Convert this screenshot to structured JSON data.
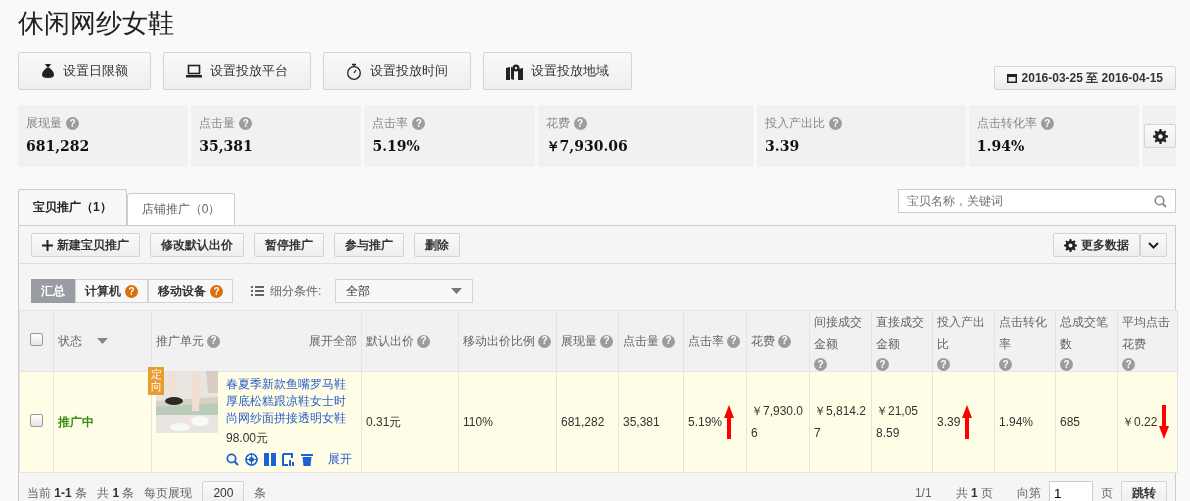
{
  "title": "休闲网纱女鞋",
  "actions": [
    {
      "kind": "money",
      "label": "设置日限额"
    },
    {
      "kind": "laptop",
      "label": "设置投放平台"
    },
    {
      "kind": "timer",
      "label": "设置投放时间"
    },
    {
      "kind": "map",
      "label": "设置投放地域"
    }
  ],
  "date_range": "2016-03-25 至 2016-04-15",
  "stats": [
    {
      "label": "展现量",
      "help": "?",
      "value": "681,282"
    },
    {
      "label": "点击量",
      "help": "?",
      "value": "35,381"
    },
    {
      "label": "点击率",
      "help": "?",
      "value": "5.19%"
    },
    {
      "label": "花费",
      "help": "?",
      "value": "￥7,930.06"
    },
    {
      "label": "投入产出比",
      "help": "?",
      "value": "3.39"
    },
    {
      "label": "点击转化率",
      "help": "?",
      "value": "1.94%"
    }
  ],
  "tabs": [
    {
      "label": "宝贝推广（1）",
      "selected": true
    },
    {
      "label": "店铺推广（0）",
      "selected": false
    }
  ],
  "search": {
    "placeholder": "宝贝名称，关键词"
  },
  "toolbar": [
    {
      "kind": "add",
      "label": "新建宝贝推广"
    },
    {
      "kind": "plain",
      "label": "修改默认出价"
    },
    {
      "kind": "plain",
      "label": "暂停推广"
    },
    {
      "kind": "plain",
      "label": "参与推广"
    },
    {
      "kind": "plain",
      "label": "删除"
    }
  ],
  "more_data": "更多数据",
  "segments": [
    {
      "label": "汇总",
      "selected": true
    },
    {
      "label": "计算机",
      "selected": false,
      "help": "?"
    },
    {
      "label": "移动设备",
      "selected": false,
      "help": "?"
    }
  ],
  "filter": {
    "label": "细分条件:",
    "value": "全部"
  },
  "table": {
    "select_all": false,
    "columns": [
      {
        "label": "状态",
        "kind": "sortable"
      },
      {
        "label": "推广单元",
        "help": "?",
        "extra": "展开全部"
      },
      {
        "label": "默认出价",
        "help": "?"
      },
      {
        "label": "移动出价比例",
        "help": "?"
      },
      {
        "label": "展现量",
        "help": "?"
      },
      {
        "label": "点击量",
        "help": "?"
      },
      {
        "label": "点击率",
        "help": "?"
      },
      {
        "label": "花费",
        "help": "?"
      },
      {
        "label": "间接成交金额",
        "help": "?"
      },
      {
        "label": "直接成交金额",
        "help": "?"
      },
      {
        "label": "投入产出比",
        "help": "?"
      },
      {
        "label": "点击转化率",
        "help": "?"
      },
      {
        "label": "总成交笔数",
        "help": "?"
      },
      {
        "label": "平均点击花费",
        "help": "?"
      }
    ],
    "rows": [
      {
        "checked": false,
        "cells": [
          {
            "kind": "status",
            "text": "推广中"
          },
          {
            "kind": "product",
            "badge": "定向",
            "title": "春夏季新款鱼嘴罗马鞋厚底松糕跟凉鞋女士时尚网纱面拼接透明女鞋",
            "price": "98.00元",
            "expand": "展开"
          },
          {
            "kind": "plain",
            "text": "0.31元"
          },
          {
            "kind": "plain",
            "text": "110%"
          },
          {
            "kind": "plain",
            "text": "681,282"
          },
          {
            "kind": "plain",
            "text": "35,381"
          },
          {
            "kind": "up",
            "text": "5.19%"
          },
          {
            "kind": "plain",
            "text": "￥7,930.06"
          },
          {
            "kind": "plain",
            "text": "￥5,814.27"
          },
          {
            "kind": "plain",
            "text": "￥21,058.59"
          },
          {
            "kind": "up",
            "text": "3.39"
          },
          {
            "kind": "plain",
            "text": "1.94%"
          },
          {
            "kind": "plain",
            "text": "685"
          },
          {
            "kind": "down",
            "text": "￥0.22"
          }
        ]
      }
    ]
  },
  "footer": {
    "current_label": "当前",
    "current": "1-1",
    "current_unit": "条",
    "total_label": "共",
    "total": "1",
    "total_unit": "条",
    "per_page_label": "每页展现",
    "per_page": "200",
    "per_page_unit": "条",
    "page_of": "1/1",
    "pages_label": "共",
    "pages": "1",
    "pages_unit": "页",
    "goto_label": "向第",
    "goto_value": "1",
    "goto_unit": "页",
    "jump": "跳转"
  }
}
